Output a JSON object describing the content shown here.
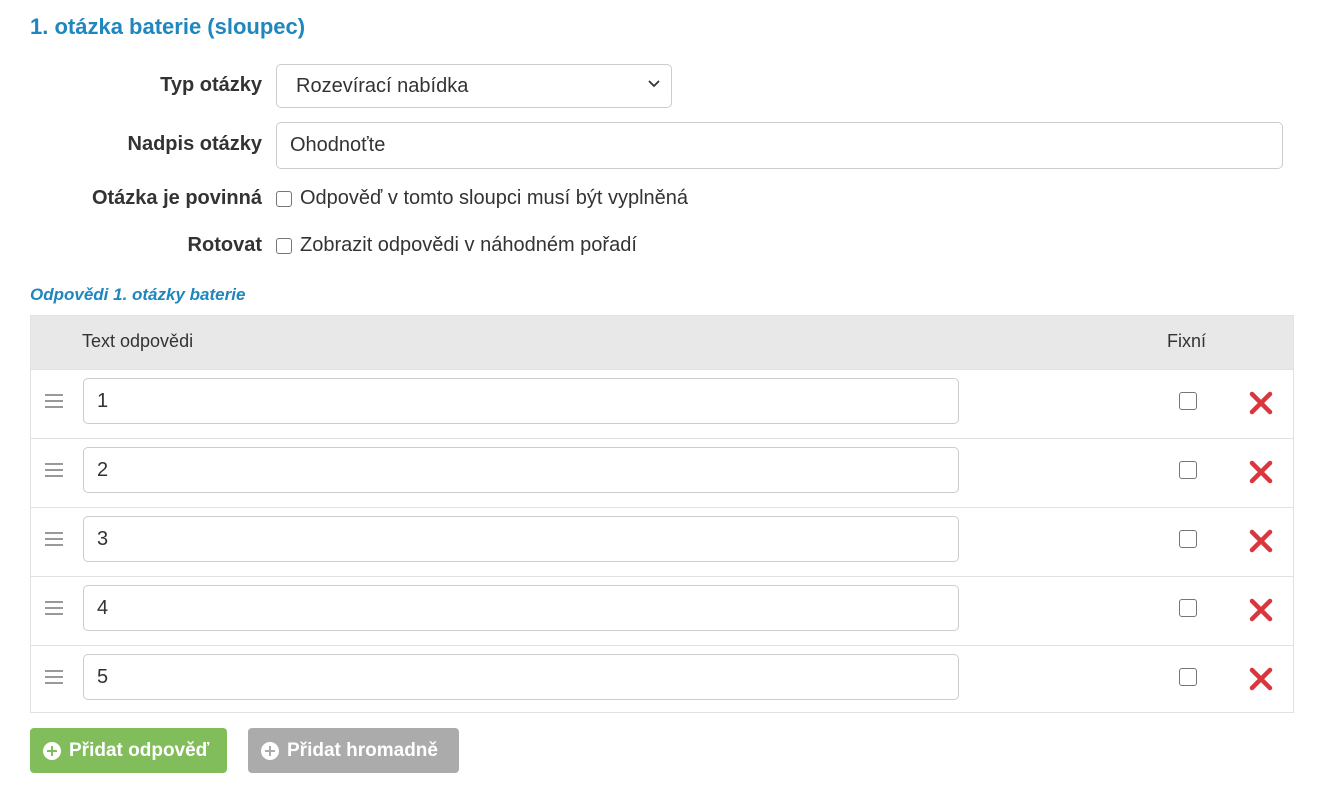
{
  "section_title": "1. otázka baterie (sloupec)",
  "form": {
    "type_label": "Typ otázky",
    "type_value": "Rozevírací nabídka",
    "caption_label": "Nadpis otázky",
    "caption_value": "Ohodnoťte",
    "required_label": "Otázka je povinná",
    "required_text": "Odpověď v tomto sloupci musí být vyplněná",
    "rotate_label": "Rotovat",
    "rotate_text": "Zobrazit odpovědi v náhodném pořadí"
  },
  "answers_title": "Odpovědi 1. otázky baterie",
  "table": {
    "col_text": "Text odpovědi",
    "col_fixed": "Fixní",
    "rows": [
      {
        "value": "1"
      },
      {
        "value": "2"
      },
      {
        "value": "3"
      },
      {
        "value": "4"
      },
      {
        "value": "5"
      }
    ]
  },
  "buttons": {
    "add_answer": "Přidat odpověď",
    "add_bulk": "Přidat hromadně"
  },
  "icons": {
    "drag_handle": "drag-handle-icon",
    "delete": "delete-x-icon",
    "plus": "plus-circle-icon",
    "chevron": "chevron-down-icon"
  },
  "colors": {
    "accent": "#1f86be",
    "add_button": "#82bd5c",
    "bulk_button": "#ababab",
    "delete": "#d9363e"
  }
}
